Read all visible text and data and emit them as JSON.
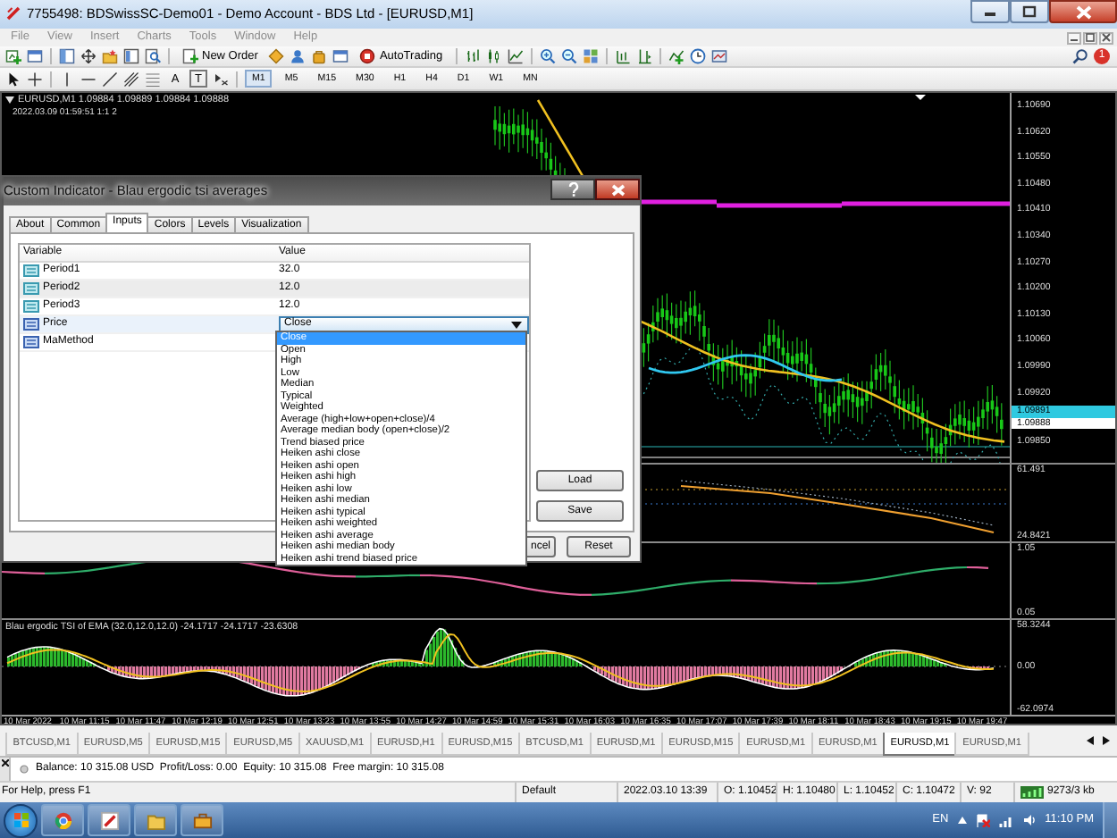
{
  "window": {
    "title": "7755498: BDSwissSC-Demo01 - Demo Account - BDS Ltd - [EURUSD,M1]"
  },
  "menu": [
    {
      "label": "File"
    },
    {
      "label": "View"
    },
    {
      "label": "Insert"
    },
    {
      "label": "Charts"
    },
    {
      "label": "Tools"
    },
    {
      "label": "Window"
    },
    {
      "label": "Help"
    }
  ],
  "toolbar": {
    "new_order": "New Order",
    "autotrading": "AutoTrading",
    "notification_count": "1"
  },
  "draw_tools": [
    {
      "label": "A"
    },
    {
      "label": "T"
    }
  ],
  "timeframes": [
    {
      "label": "M1",
      "selected": true
    },
    {
      "label": "M5",
      "selected": false
    },
    {
      "label": "M15",
      "selected": false
    },
    {
      "label": "M30",
      "selected": false
    },
    {
      "label": "H1",
      "selected": false
    },
    {
      "label": "H4",
      "selected": false
    },
    {
      "label": "D1",
      "selected": false
    },
    {
      "label": "W1",
      "selected": false
    },
    {
      "label": "MN",
      "selected": false
    }
  ],
  "chart": {
    "header": "EURUSD,M1  1.09884 1.09889 1.09884 1.09888",
    "subheader": "2022.03.09 01:59:51 1:1 2",
    "price_labels": [
      {
        "text": "1.10690",
        "kind": "tick"
      },
      {
        "text": "1.10620",
        "kind": "tick"
      },
      {
        "text": "1.10550",
        "kind": "tick"
      },
      {
        "text": "1.10480",
        "kind": "tick"
      },
      {
        "text": "1.10410",
        "kind": "tick"
      },
      {
        "text": "1.10340",
        "kind": "tick"
      },
      {
        "text": "1.10270",
        "kind": "tick"
      },
      {
        "text": "1.10200",
        "kind": "tick"
      },
      {
        "text": "1.10130",
        "kind": "tick"
      },
      {
        "text": "1.10060",
        "kind": "tick"
      },
      {
        "text": "1.09990",
        "kind": "tick"
      },
      {
        "text": "1.09920",
        "kind": "tick"
      },
      {
        "text": "1.09891",
        "kind": "bid"
      },
      {
        "text": "1.09888",
        "kind": "last"
      },
      {
        "text": "1.09850",
        "kind": "tick"
      }
    ],
    "subwindows": [
      {
        "scale_labels": [
          "61.491",
          "24.8421"
        ]
      },
      {
        "scale_labels": [
          "1.05",
          "0.05"
        ]
      },
      {
        "title": "Blau ergodic TSI of EMA (32.0,12.0,12.0) -24.1717 -24.1717 -23.6308",
        "scale_labels": [
          "58.3244",
          "0.00",
          "-62.0974"
        ]
      }
    ],
    "time_labels": [
      "10 Mar 2022",
      "10 Mar 11:15",
      "10 Mar 11:47",
      "10 Mar 12:19",
      "10 Mar 12:51",
      "10 Mar 13:23",
      "10 Mar 13:55",
      "10 Mar 14:27",
      "10 Mar 14:59",
      "10 Mar 15:31",
      "10 Mar 16:03",
      "10 Mar 16:35",
      "10 Mar 17:07",
      "10 Mar 17:39",
      "10 Mar 18:11",
      "10 Mar 18:43",
      "10 Mar 19:15",
      "10 Mar 19:47"
    ]
  },
  "dialog": {
    "title": "Custom Indicator - Blau ergodic tsi averages",
    "tabs": [
      {
        "label": "About",
        "selected": false
      },
      {
        "label": "Common",
        "selected": false
      },
      {
        "label": "Inputs",
        "selected": true
      },
      {
        "label": "Colors",
        "selected": false
      },
      {
        "label": "Levels",
        "selected": false
      },
      {
        "label": "Visualization",
        "selected": false
      }
    ],
    "columns": [
      "Variable",
      "Value"
    ],
    "rows": [
      {
        "variable": "Period1",
        "value": "32.0",
        "kind": "number",
        "selected": false
      },
      {
        "variable": "Period2",
        "value": "12.0",
        "kind": "number",
        "selected": false
      },
      {
        "variable": "Period3",
        "value": "12.0",
        "kind": "number",
        "selected": false
      },
      {
        "variable": "Price",
        "value": "Close",
        "kind": "enum",
        "selected": true
      },
      {
        "variable": "MaMethod",
        "kind": "enum",
        "selected": false
      }
    ],
    "dropdown_options": [
      {
        "label": "Close",
        "selected": true
      },
      {
        "label": "Open",
        "selected": false
      },
      {
        "label": "High",
        "selected": false
      },
      {
        "label": "Low",
        "selected": false
      },
      {
        "label": "Median",
        "selected": false
      },
      {
        "label": "Typical",
        "selected": false
      },
      {
        "label": "Weighted",
        "selected": false
      },
      {
        "label": "Average (high+low+open+close)/4",
        "selected": false
      },
      {
        "label": "Average median body (open+close)/2",
        "selected": false
      },
      {
        "label": "Trend biased price",
        "selected": false
      },
      {
        "label": "Heiken ashi close",
        "selected": false
      },
      {
        "label": "Heiken ashi open",
        "selected": false
      },
      {
        "label": "Heiken ashi high",
        "selected": false
      },
      {
        "label": "Heiken ashi low",
        "selected": false
      },
      {
        "label": "Heiken ashi median",
        "selected": false
      },
      {
        "label": "Heiken ashi typical",
        "selected": false
      },
      {
        "label": "Heiken ashi weighted",
        "selected": false
      },
      {
        "label": "Heiken ashi average",
        "selected": false
      },
      {
        "label": "Heiken ashi median body",
        "selected": false
      },
      {
        "label": "Heiken ashi trend biased price",
        "selected": false
      }
    ],
    "side_buttons": [
      "Load",
      "Save"
    ],
    "bottom_buttons": [
      "ncel",
      "Reset"
    ]
  },
  "chart_tabs": [
    {
      "label": "BTCUSD,M1",
      "selected": false
    },
    {
      "label": "EURUSD,M5",
      "selected": false
    },
    {
      "label": "EURUSD,M15",
      "selected": false
    },
    {
      "label": "EURUSD,M5",
      "selected": false
    },
    {
      "label": "XAUUSD,M1",
      "selected": false
    },
    {
      "label": "EURUSD,H1",
      "selected": false
    },
    {
      "label": "EURUSD,M15",
      "selected": false
    },
    {
      "label": "BTCUSD,M1",
      "selected": false
    },
    {
      "label": "EURUSD,M1",
      "selected": false
    },
    {
      "label": "EURUSD,M15",
      "selected": false
    },
    {
      "label": "EURUSD,M1",
      "selected": false
    },
    {
      "label": "EURUSD,M1",
      "selected": false
    },
    {
      "label": "EURUSD,M1",
      "selected": true
    },
    {
      "label": "EURUSD,M1",
      "selected": false
    }
  ],
  "terminal": {
    "balance_line": "Balance: 10 315.08 USD  Profit/Loss: 0.00  Equity: 10 315.08  Free margin: 10 315.08"
  },
  "status_bar": {
    "help": "For Help, press F1",
    "profile": "Default",
    "time": "2022.03.10 13:39",
    "open": "O: 1.10452",
    "high": "H: 1.10480",
    "low": "L: 1.10452",
    "close": "C: 1.10472",
    "volume": "V: 92",
    "traffic": "9273/3 kb"
  },
  "taskbar": {
    "language": "EN",
    "clock": "11:10 PM"
  }
}
